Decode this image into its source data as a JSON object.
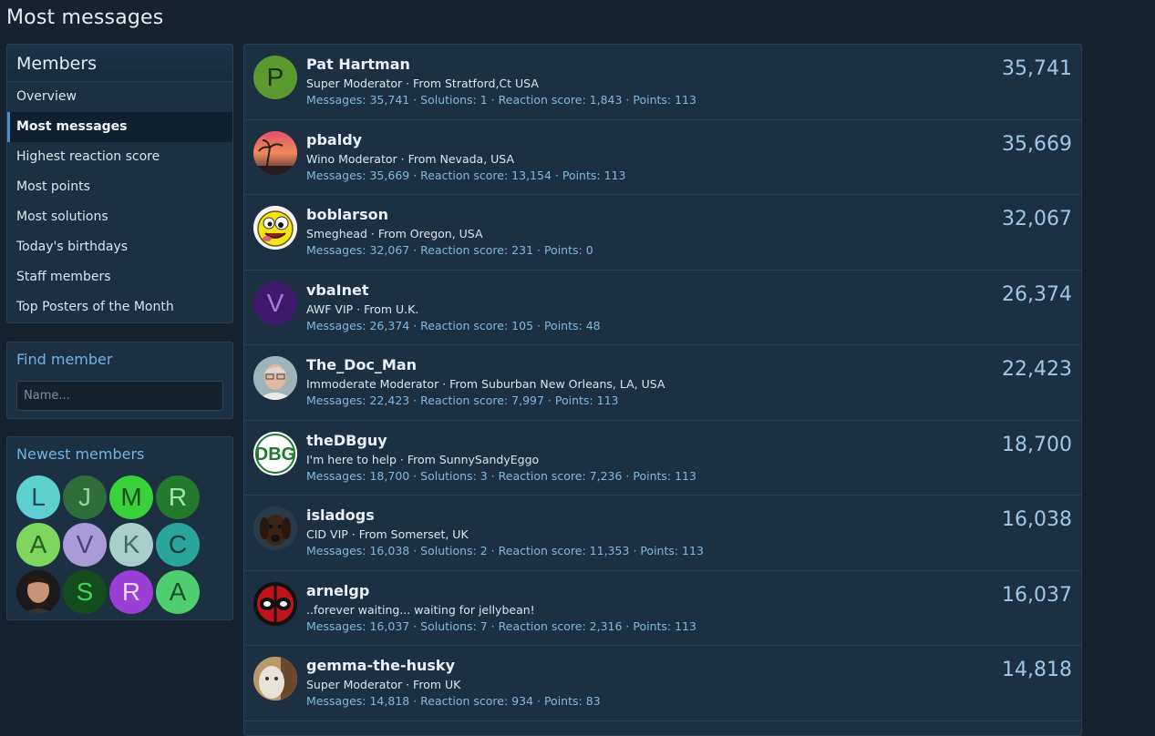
{
  "page": {
    "title": "Most messages"
  },
  "sidebar": {
    "members": {
      "title": "Members",
      "items": [
        {
          "label": "Overview",
          "active": false
        },
        {
          "label": "Most messages",
          "active": true
        },
        {
          "label": "Highest reaction score",
          "active": false
        },
        {
          "label": "Most points",
          "active": false
        },
        {
          "label": "Most solutions",
          "active": false
        },
        {
          "label": "Today's birthdays",
          "active": false
        },
        {
          "label": "Staff members",
          "active": false
        },
        {
          "label": "Top Posters of the Month",
          "active": false
        }
      ]
    },
    "find": {
      "title": "Find member",
      "placeholder": "Name..."
    },
    "newest": {
      "title": "Newest members",
      "avatars": [
        {
          "letter": "L",
          "bg": "#5ccfcf",
          "fg": "#1d4d4f"
        },
        {
          "letter": "J",
          "bg": "#2f6e3a",
          "fg": "#8fd69a"
        },
        {
          "letter": "M",
          "bg": "#3ad23a",
          "fg": "#0f4d12"
        },
        {
          "letter": "R",
          "bg": "#237a2a",
          "fg": "#a6e6ac"
        },
        {
          "letter": "A",
          "bg": "#7ed65e",
          "fg": "#2b5c1c"
        },
        {
          "letter": "V",
          "bg": "#a99bd8",
          "fg": "#4b3d80"
        },
        {
          "letter": "K",
          "bg": "#a8cfc9",
          "fg": "#3d6b64"
        },
        {
          "letter": "C",
          "bg": "#2aa59a",
          "fg": "#0c3a35"
        },
        {
          "letter": "",
          "bg": "#3a2a22",
          "fg": "#ffffff",
          "photo": "bearded-man"
        },
        {
          "letter": "S",
          "bg": "#144d1c",
          "fg": "#43d15a"
        },
        {
          "letter": "R",
          "bg": "#9b3fd6",
          "fg": "#ead6fa"
        },
        {
          "letter": "A",
          "bg": "#4fce6f",
          "fg": "#15522a"
        }
      ]
    }
  },
  "members": [
    {
      "name": "Pat Hartman",
      "title": "Super Moderator · From Stratford,Ct USA",
      "stats": "Messages: 35,741 · Solutions: 1 · Reaction score: 1,843 · Points: 113",
      "count": "35,741",
      "avatar": {
        "letter": "P",
        "bg": "#5a9a2f",
        "fg": "#17300a"
      }
    },
    {
      "name": "pbaldy",
      "title": "Wino Moderator · From Nevada, USA",
      "stats": "Messages: 35,669 · Reaction score: 13,154 · Points: 113",
      "count": "35,669",
      "avatar": {
        "letter": "",
        "bg": "#c14a50",
        "fg": "#fff",
        "photo": "sunset-palm"
      }
    },
    {
      "name": "boblarson",
      "title": "Smeghead · From Oregon, USA",
      "stats": "Messages: 32,067 · Reaction score: 231 · Points: 0",
      "count": "32,067",
      "avatar": {
        "letter": "",
        "bg": "#f2f2f2",
        "fg": "#000",
        "photo": "crazy-smiley"
      }
    },
    {
      "name": "vbaInet",
      "title": "AWF VIP · From U.K.",
      "stats": "Messages: 26,374 · Reaction score: 105 · Points: 48",
      "count": "26,374",
      "avatar": {
        "letter": "V",
        "bg": "#3d1a6b",
        "fg": "#a57be0"
      }
    },
    {
      "name": "The_Doc_Man",
      "title": "Immoderate Moderator · From Suburban New Orleans, LA, USA",
      "stats": "Messages: 22,423 · Reaction score: 7,997 · Points: 113",
      "count": "22,423",
      "avatar": {
        "letter": "",
        "bg": "#9ab0b5",
        "fg": "#fff",
        "photo": "man-glasses"
      }
    },
    {
      "name": "theDBguy",
      "title": "I'm here to help · From SunnySandyEggo",
      "stats": "Messages: 18,700 · Solutions: 3 · Reaction score: 7,236 · Points: 113",
      "count": "18,700",
      "avatar": {
        "letter": "",
        "bg": "#ffffff",
        "fg": "#1f7a2e",
        "photo": "dbg-logo"
      }
    },
    {
      "name": "isladogs",
      "title": "CID VIP · From Somerset, UK",
      "stats": "Messages: 16,038 · Solutions: 2 · Reaction score: 11,353 · Points: 113",
      "count": "16,038",
      "avatar": {
        "letter": "",
        "bg": "#1d3042",
        "fg": "#fff",
        "photo": "dog"
      }
    },
    {
      "name": "arnelgp",
      "title": "..forever waiting... waiting for jellybean!",
      "stats": "Messages: 16,037 · Solutions: 7 · Reaction score: 2,316 · Points: 113",
      "count": "16,037",
      "avatar": {
        "letter": "",
        "bg": "#111111",
        "fg": "#fff",
        "photo": "deadpool"
      }
    },
    {
      "name": "gemma-the-husky",
      "title": "Super Moderator · From UK",
      "stats": "Messages: 14,818 · Reaction score: 934 · Points: 83",
      "count": "14,818",
      "avatar": {
        "letter": "",
        "bg": "#c9b8a0",
        "fg": "#fff",
        "photo": "husky"
      }
    }
  ]
}
